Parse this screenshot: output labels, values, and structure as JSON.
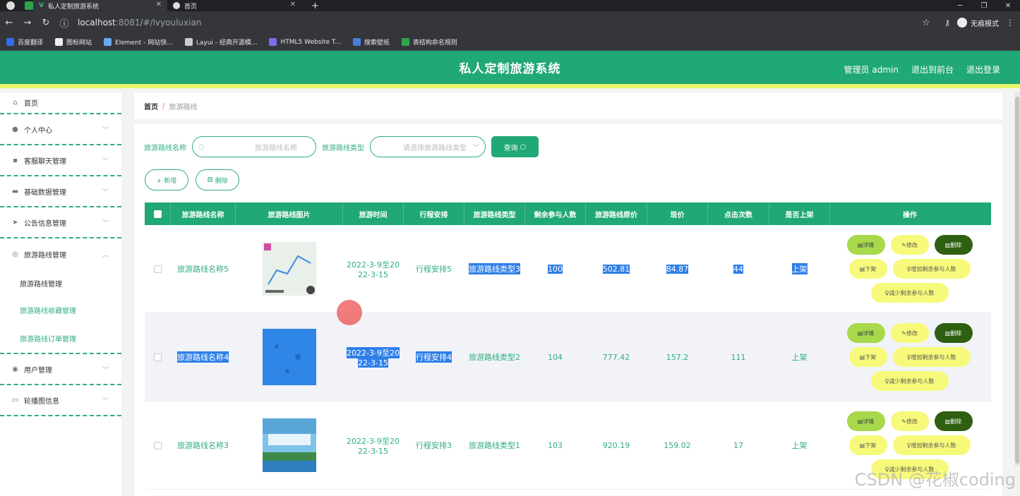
{
  "browser": {
    "tabs": [
      {
        "title": "私人定制旅游系统",
        "close": "✕"
      },
      {
        "title": "首页",
        "close": "✕"
      }
    ],
    "new_tab": "+",
    "window_controls": [
      "─",
      "❐",
      "✕"
    ],
    "url_host": "localhost",
    "url_rest": ":8081/#/lvyouluxian",
    "guest_label": "无痕模式",
    "bookmarks": [
      "百度翻译",
      "图标网站",
      "Element - 网站快...",
      "Layui - 经典开源模...",
      "HTML5 Website T...",
      "搜索壁纸",
      "表结构命名规则"
    ]
  },
  "header": {
    "title": "私人定制旅游系统",
    "admin": "管理员 admin",
    "to_front": "退出到前台",
    "logout": "退出登录"
  },
  "sidebar": {
    "items": [
      {
        "label": "首页",
        "icon": "home-icon"
      },
      {
        "label": "个人中心",
        "icon": "user-icon"
      },
      {
        "label": "客服聊天管理",
        "icon": "chat-icon"
      },
      {
        "label": "基础数据管理",
        "icon": "data-icon"
      },
      {
        "label": "公告信息管理",
        "icon": "notice-icon"
      },
      {
        "label": "旅游路线管理",
        "icon": "route-icon"
      }
    ],
    "subitems": [
      "旅游路线管理",
      "旅游路线收藏管理",
      "旅游路线订单管理"
    ],
    "items2": [
      {
        "label": "用户管理",
        "icon": "users-icon"
      },
      {
        "label": "轮播图信息",
        "icon": "carousel-icon"
      }
    ]
  },
  "breadcrumb": {
    "home": "首页",
    "sep": "/",
    "current": "旅游路线"
  },
  "search": {
    "name_label": "旅游路线名称",
    "name_placeholder": "旅游路线名称",
    "type_label": "旅游路线类型",
    "type_placeholder": "请选择旅游路线类型",
    "query_button": "查询"
  },
  "actions": {
    "add": "+ 新增",
    "delete": "删除"
  },
  "table": {
    "headers": [
      "旅游路线名称",
      "旅游路线图片",
      "旅游时间",
      "行程安排",
      "旅游路线类型",
      "剩余参与人数",
      "旅游路线原价",
      "现价",
      "点击次数",
      "是否上架",
      "操作"
    ],
    "rows": [
      {
        "name": "旅游路线名称5",
        "time1": "2022-3-9至20",
        "time2": "22-3-15",
        "plan": "行程安排5",
        "type": "旅游路线类型3",
        "remain": "100",
        "orig": "502.81",
        "price": "84.87",
        "clicks": "44",
        "status": "上架"
      },
      {
        "name": "旅游路线名称4",
        "time1": "2022-3-9至20",
        "time2": "22-3-15",
        "plan": "行程安排4",
        "type": "旅游路线类型2",
        "remain": "104",
        "orig": "777.42",
        "price": "157.2",
        "clicks": "111",
        "status": "上架"
      },
      {
        "name": "旅游路线名称3",
        "time1": "2022-3-9至20",
        "time2": "22-3-15",
        "plan": "行程安排3",
        "type": "旅游路线类型1",
        "remain": "103",
        "orig": "920.19",
        "price": "159.02",
        "clicks": "17",
        "status": "上架"
      }
    ],
    "ops": {
      "detail": "详情",
      "edit": "修改",
      "delete": "删除",
      "off": "下架",
      "add_remain": "增加剩余参与人数",
      "sub_remain": "减少剩余参与人数"
    }
  },
  "colors": {
    "brand": "#20a876",
    "accent_bar": "#e8f56b",
    "highlight": "#2f7fe8"
  },
  "watermark": "CSDN @花椒coding"
}
